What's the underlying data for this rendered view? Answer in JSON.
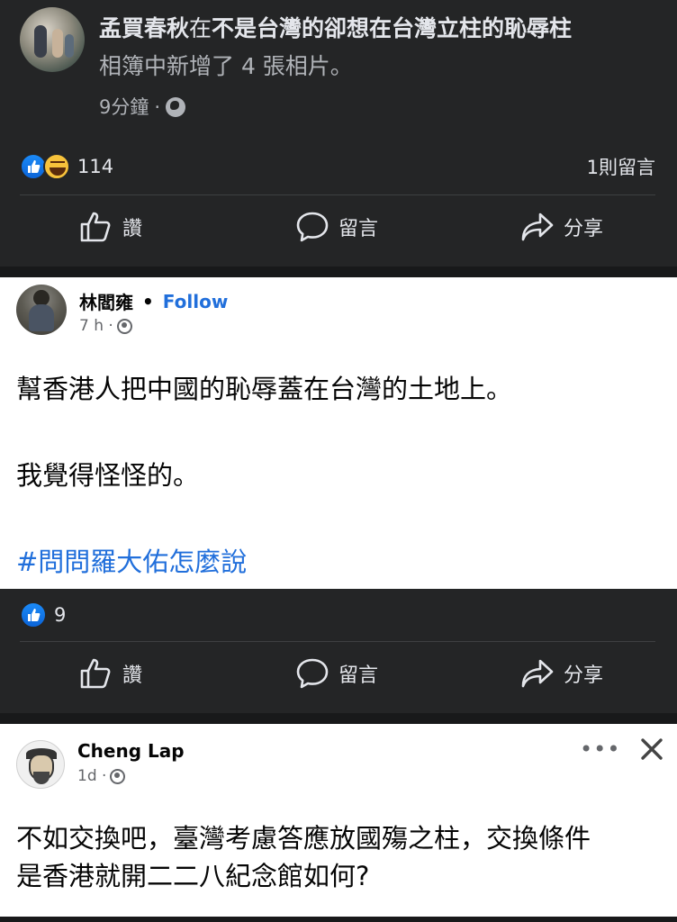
{
  "post1": {
    "author": "孟買春秋",
    "connector": "在",
    "group": "不是台灣的卻想在台灣立柱的恥辱柱",
    "subtitle": "相簿中新增了 4 張相片。",
    "time": "9分鐘",
    "separator": "·",
    "privacy_icon": "globe-icon",
    "reactions": [
      "like",
      "haha"
    ],
    "reaction_count": "114",
    "comment_count": "1則留言",
    "actions": {
      "like": "讚",
      "comment": "留言",
      "share": "分享"
    }
  },
  "post2": {
    "author": "林閻雍",
    "dot": "•",
    "follow": "Follow",
    "time": "7 h ·",
    "line1": "幫香港人把中國的恥辱蓋在台灣的土地上。",
    "line2": "我覺得怪怪的。",
    "hashtag": "#問問羅大佑怎麼說",
    "reaction_count": "9",
    "actions": {
      "like": "讚",
      "comment": "留言",
      "share": "分享"
    }
  },
  "post3": {
    "author": "Cheng Lap",
    "time": "1d ·",
    "more": "•••",
    "line1": "不如交換吧，臺灣考慮答應放國殤之柱，交換條件",
    "line2": "是香港就開二二八紀念館如何?"
  },
  "colors": {
    "dark_bg": "#242526",
    "dark_text": "#e4e6eb",
    "secondary_text": "#b0b3b8",
    "link_blue": "#216fdb",
    "like_blue": "#1b8af7"
  }
}
